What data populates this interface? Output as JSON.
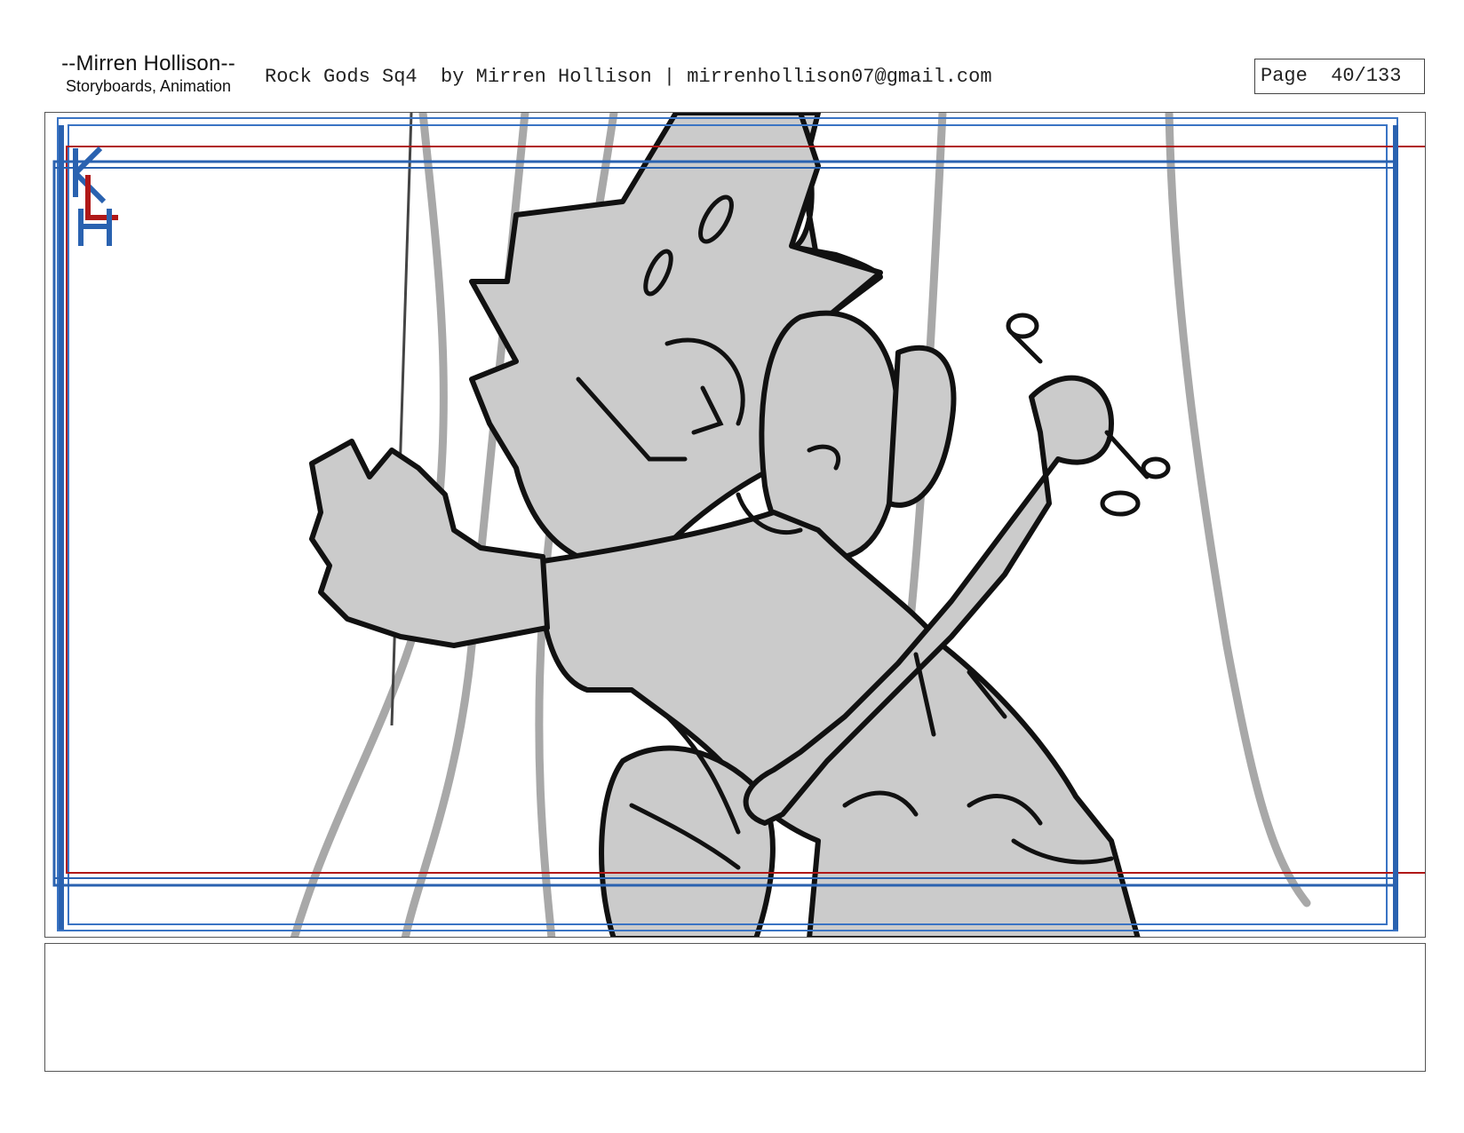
{
  "header": {
    "brand_name": "--Mirren Hollison--",
    "brand_sub": "Storyboards, Animation",
    "info": "Rock Gods Sq4  by Mirren Hollison | mirrenhollison07@gmail.com",
    "page_label": "Page",
    "page_number": "40/133"
  },
  "panel": {
    "guide_colors": {
      "action_safe": "#2a62b0",
      "title_safe": "#b01818",
      "frame": "#3a74c4"
    },
    "logo_letters": "KLH",
    "notes_text": ""
  }
}
